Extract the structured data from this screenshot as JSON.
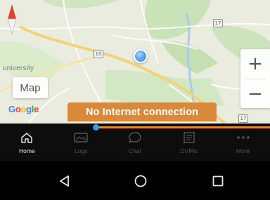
{
  "map": {
    "type_button_label": "Map",
    "place_label": "university",
    "google_logo": {
      "letters": [
        "G",
        "o",
        "o",
        "g",
        "l",
        "e"
      ],
      "colors": [
        "#4285f4",
        "#ea4335",
        "#fbbc05",
        "#4285f4",
        "#34a853",
        "#ea4335"
      ]
    },
    "road_shields": [
      "17",
      "10",
      "17"
    ],
    "zoom_in_label": "+",
    "zoom_out_label": "−"
  },
  "toast": {
    "message": "No Internet connection",
    "color": "#d9893a"
  },
  "progress": {
    "fraction": 0.64,
    "fill_color": "#e98a2a",
    "knob_color": "#3b9be6"
  },
  "bottom_nav": {
    "items": [
      {
        "label": "Home",
        "icon": "home-icon",
        "active": true
      },
      {
        "label": "Logs",
        "icon": "image-icon",
        "active": false
      },
      {
        "label": "Chat",
        "icon": "chat-bubble-icon",
        "active": false
      },
      {
        "label": "DVIRs",
        "icon": "document-icon",
        "active": false
      },
      {
        "label": "More",
        "icon": "more-dots-icon",
        "active": false
      }
    ]
  },
  "system_nav": {
    "buttons": [
      "back-icon",
      "home-circle-icon",
      "recent-apps-icon"
    ]
  },
  "colors": {
    "map_land": "#e9ecdf",
    "map_park": "#c5e0b4",
    "map_road_major": "#f4d27a",
    "nav_background": "#0d0d0d"
  }
}
